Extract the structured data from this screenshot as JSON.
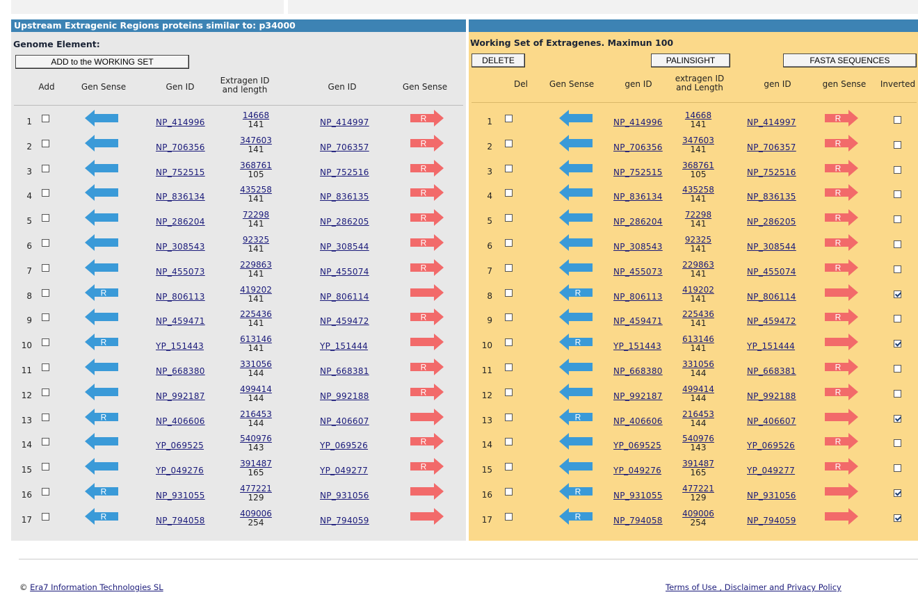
{
  "left": {
    "title": "Upstream Extragenic Regions proteins similar to: p34000",
    "section": "Genome Element:",
    "add_button": "ADD to the WORKING SET",
    "headers": [
      "Add",
      "Gen Sense",
      "Gen ID",
      "Extragen ID\nand length",
      "Gen ID",
      "Gen Sense"
    ]
  },
  "right": {
    "title": "Working Set of Extragenes. Maximun 100",
    "delete_button": "DELETE",
    "palinsight_button": "PALINSIGHT",
    "fasta_button": "FASTA SEQUENCES",
    "headers": [
      "Del",
      "Gen Sense",
      "gen ID",
      "extragen ID\nand Length",
      "gen ID",
      "gen Sense",
      "Inverted"
    ]
  },
  "colors": {
    "blue_arrow": "#3a9ad8",
    "red_arrow": "#f26a6a",
    "title_bar": "#3d83b4",
    "working_bg": "#fbd98a"
  },
  "icons": {
    "left_arrow": "left-arrow-icon",
    "right_arrow": "right-arrow-icon",
    "r_marker": "R"
  },
  "rows": [
    {
      "n": "1",
      "gen1": "NP_414996",
      "ext_id": "14668",
      "len": "141",
      "gen2": "NP_414997",
      "r_side": "right",
      "inverted": false
    },
    {
      "n": "2",
      "gen1": "NP_706356",
      "ext_id": "347603",
      "len": "141",
      "gen2": "NP_706357",
      "r_side": "right",
      "inverted": false
    },
    {
      "n": "3",
      "gen1": "NP_752515",
      "ext_id": "368761",
      "len": "105",
      "gen2": "NP_752516",
      "r_side": "right",
      "inverted": false
    },
    {
      "n": "4",
      "gen1": "NP_836134",
      "ext_id": "435258",
      "len": "141",
      "gen2": "NP_836135",
      "r_side": "right",
      "inverted": false
    },
    {
      "n": "5",
      "gen1": "NP_286204",
      "ext_id": "72298",
      "len": "141",
      "gen2": "NP_286205",
      "r_side": "right",
      "inverted": false
    },
    {
      "n": "6",
      "gen1": "NP_308543",
      "ext_id": "92325",
      "len": "141",
      "gen2": "NP_308544",
      "r_side": "right",
      "inverted": false
    },
    {
      "n": "7",
      "gen1": "NP_455073",
      "ext_id": "229863",
      "len": "141",
      "gen2": "NP_455074",
      "r_side": "right",
      "inverted": false
    },
    {
      "n": "8",
      "gen1": "NP_806113",
      "ext_id": "419202",
      "len": "141",
      "gen2": "NP_806114",
      "r_side": "left",
      "inverted": true
    },
    {
      "n": "9",
      "gen1": "NP_459471",
      "ext_id": "225436",
      "len": "141",
      "gen2": "NP_459472",
      "r_side": "right",
      "inverted": false
    },
    {
      "n": "10",
      "gen1": "YP_151443",
      "ext_id": "613146",
      "len": "141",
      "gen2": "YP_151444",
      "r_side": "left",
      "inverted": true
    },
    {
      "n": "11",
      "gen1": "NP_668380",
      "ext_id": "331056",
      "len": "144",
      "gen2": "NP_668381",
      "r_side": "right",
      "inverted": false
    },
    {
      "n": "12",
      "gen1": "NP_992187",
      "ext_id": "499414",
      "len": "144",
      "gen2": "NP_992188",
      "r_side": "right",
      "inverted": false
    },
    {
      "n": "13",
      "gen1": "NP_406606",
      "ext_id": "216453",
      "len": "144",
      "gen2": "NP_406607",
      "r_side": "left",
      "inverted": true
    },
    {
      "n": "14",
      "gen1": "YP_069525",
      "ext_id": "540976",
      "len": "143",
      "gen2": "YP_069526",
      "r_side": "right",
      "inverted": false
    },
    {
      "n": "15",
      "gen1": "YP_049276",
      "ext_id": "391487",
      "len": "165",
      "gen2": "YP_049277",
      "r_side": "right",
      "inverted": false
    },
    {
      "n": "16",
      "gen1": "NP_931055",
      "ext_id": "477221",
      "len": "129",
      "gen2": "NP_931056",
      "r_side": "left",
      "inverted": true
    },
    {
      "n": "17",
      "gen1": "NP_794058",
      "ext_id": "409006",
      "len": "254",
      "gen2": "NP_794059",
      "r_side": "left",
      "inverted": true
    }
  ],
  "footer": {
    "copyright_symbol": "©",
    "company": "Era7 Information Technologies SL",
    "links": "Terms of Use , Disclaimer and Privacy Policy"
  }
}
